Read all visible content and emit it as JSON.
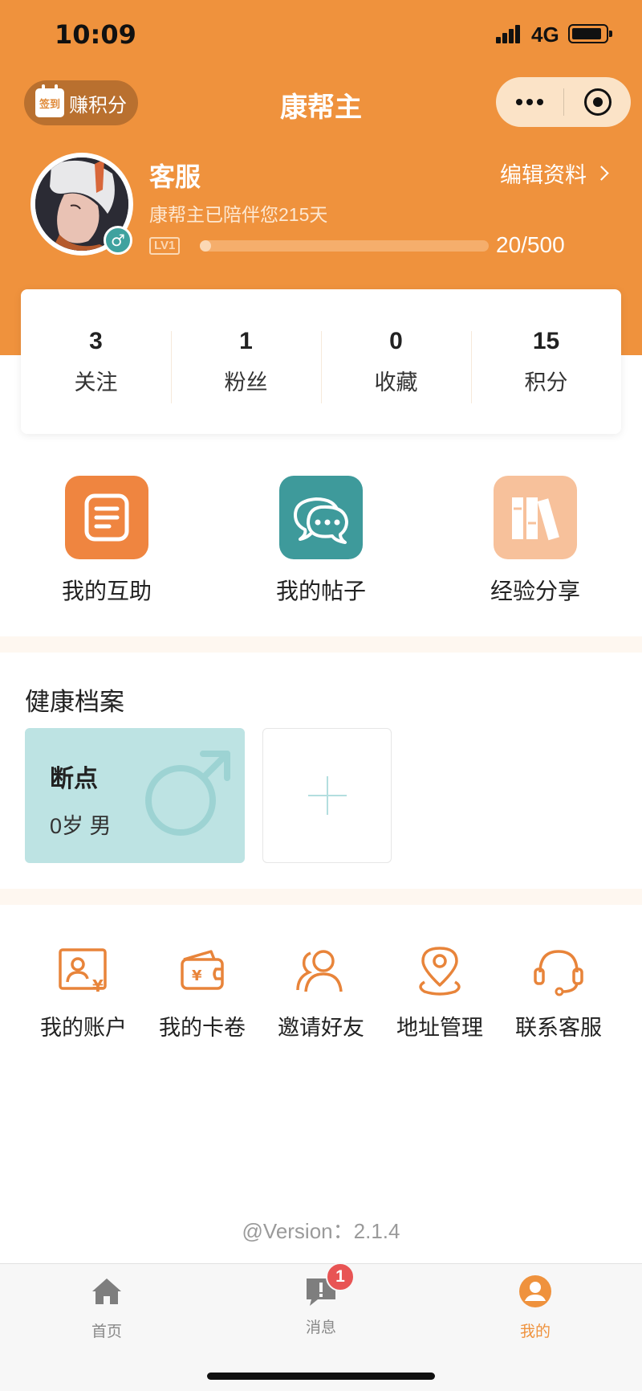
{
  "status_bar": {
    "time": "10:09",
    "network": "4G"
  },
  "nav": {
    "checkin_icon_text": "签到",
    "checkin_label": "赚积分",
    "title": "康帮主"
  },
  "profile": {
    "name": "客服",
    "days_text": "康帮主已陪伴您215天",
    "level": "LV1",
    "progress_text": "20/500",
    "progress_fraction": 0.04,
    "gender_symbol": "♂",
    "edit_label": "编辑资料"
  },
  "stats": [
    {
      "value": "3",
      "label": "关注"
    },
    {
      "value": "1",
      "label": "粉丝"
    },
    {
      "value": "0",
      "label": "收藏"
    },
    {
      "value": "15",
      "label": "积分"
    }
  ],
  "tiles": [
    {
      "label": "我的互助",
      "icon": "document-icon",
      "color": "#EF8540"
    },
    {
      "label": "我的帖子",
      "icon": "chat-bubbles-icon",
      "color": "#3E9A9B"
    },
    {
      "label": "经验分享",
      "icon": "books-icon",
      "color": "#F7C19B"
    }
  ],
  "health": {
    "title": "健康档案",
    "card_name": "断点",
    "card_meta": "0岁 男"
  },
  "services": [
    {
      "label": "我的账户",
      "icon": "account-icon"
    },
    {
      "label": "我的卡卷",
      "icon": "wallet-icon"
    },
    {
      "label": "邀请好友",
      "icon": "invite-friends-icon"
    },
    {
      "label": "地址管理",
      "icon": "location-pin-icon"
    },
    {
      "label": "联系客服",
      "icon": "headset-icon"
    }
  ],
  "version": "@Version：2.1.4",
  "tabbar": {
    "home": "首页",
    "messages": "消息",
    "messages_badge": "1",
    "mine": "我的"
  },
  "colors": {
    "primary": "#EF923D",
    "teal": "#3E9A9B",
    "badge": "#E85454"
  }
}
